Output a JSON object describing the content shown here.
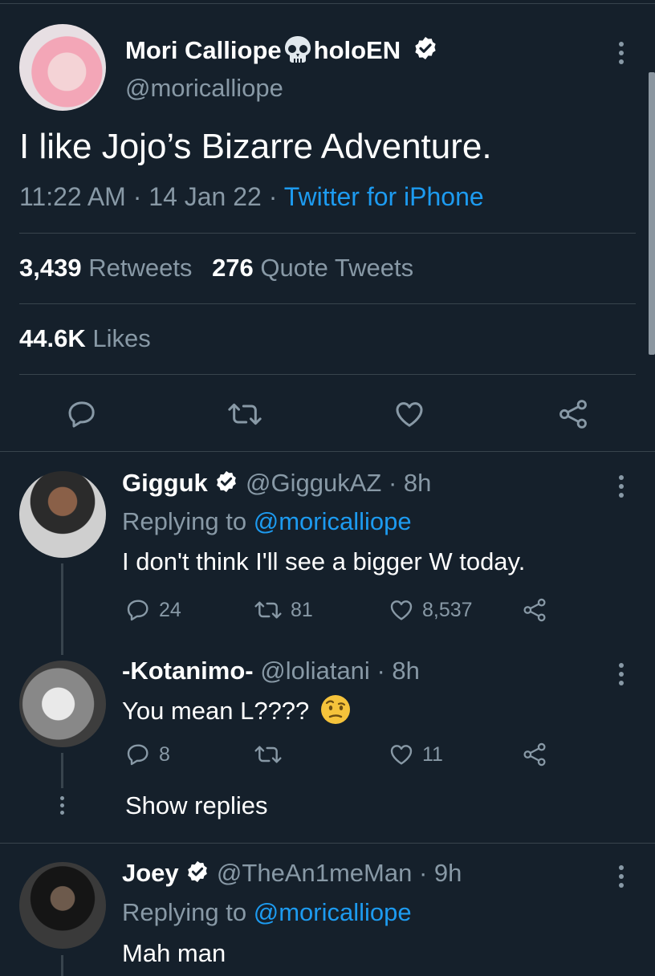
{
  "main_tweet": {
    "display_name": "Mori Calliope",
    "name_suffix": "holoEN",
    "handle": "@moricalliope",
    "text": "I like Jojo’s Bizarre Adventure.",
    "time": "11:22 AM",
    "date": "14 Jan 22",
    "source": "Twitter for iPhone",
    "retweets_count": "3,439",
    "retweets_label": "Retweets",
    "quotes_count": "276",
    "quotes_label": "Quote Tweets",
    "likes_count": "44.6K",
    "likes_label": "Likes",
    "sep": "·"
  },
  "replies": [
    {
      "display_name": "Gigguk",
      "handle": "@GiggukAZ",
      "time": "8h",
      "replying_label": "Replying to",
      "replying_to": "@moricalliope",
      "text": "I don't think I'll see a bigger W today.",
      "replies": "24",
      "retweets": "81",
      "likes": "8,537"
    },
    {
      "display_name": "-Kotanimo-",
      "handle": "@loliatani",
      "time": "8h",
      "text": "You mean L????",
      "replies": "8",
      "retweets": "",
      "likes": "11",
      "show_replies": "Show replies"
    },
    {
      "display_name": "Joey",
      "handle": "@TheAn1meMan",
      "time": "9h",
      "replying_label": "Replying to",
      "replying_to": "@moricalliope",
      "text": "Mah man"
    }
  ],
  "icons": [
    "skull-icon",
    "verified-badge-icon",
    "more-icon",
    "reply-icon",
    "retweet-icon",
    "like-icon",
    "share-icon",
    "raised-eyebrow-emoji-icon"
  ],
  "colors": {
    "background": "#15202b",
    "accent": "#1d9bf0",
    "muted": "#8899a6",
    "divider": "#38444d"
  }
}
